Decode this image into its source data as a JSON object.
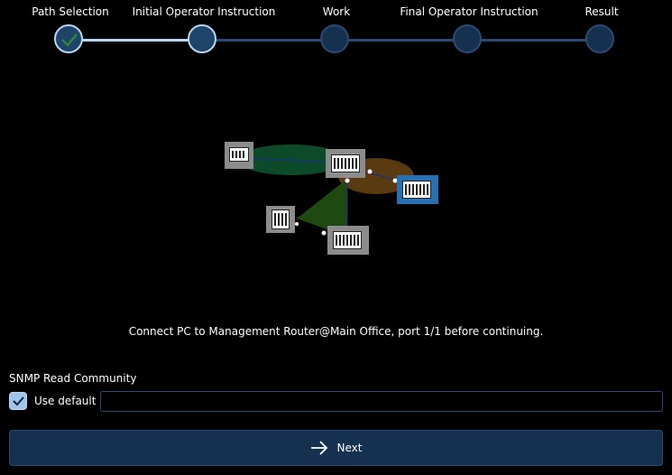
{
  "stepper": {
    "steps": [
      {
        "label": "Path Selection",
        "state": "done"
      },
      {
        "label": "Initial Operator Instruction",
        "state": "active"
      },
      {
        "label": "Work",
        "state": "pending"
      },
      {
        "label": "Final Operator Instruction",
        "state": "pending"
      },
      {
        "label": "Result",
        "state": "pending"
      }
    ]
  },
  "instruction": "Connect PC to Management Router@Main Office, port 1/1 before continuing.",
  "snmp": {
    "label": "SNMP Read Community",
    "use_default_label": "Use default",
    "use_default_checked": true,
    "value": "",
    "placeholder": ""
  },
  "next_button": {
    "label": "Next",
    "icon": "arrow-right-icon"
  },
  "colors": {
    "background": "#000000",
    "panel": "#15314f",
    "border": "#2b4a73",
    "accent": "#9fc6ea",
    "check_green": "#2e8b3a"
  }
}
